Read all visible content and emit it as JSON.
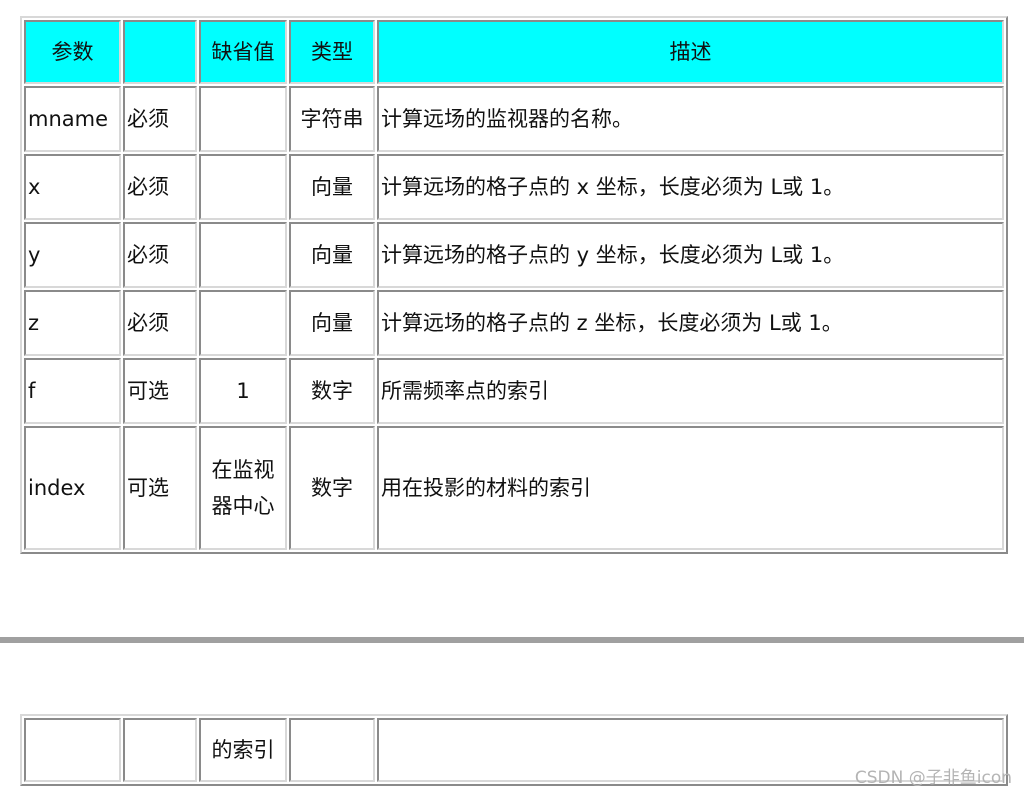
{
  "table": {
    "headers": [
      "参数",
      "",
      "缺省值",
      "类型",
      "描述"
    ],
    "rows": [
      {
        "param": "mname",
        "required": "必须",
        "default": "",
        "type": "字符串",
        "description": "计算远场的监视器的名称。"
      },
      {
        "param": "x",
        "required": "必须",
        "default": "",
        "type": "向量",
        "description": "计算远场的格子点的 x 坐标，长度必须为 L或 1。"
      },
      {
        "param": "y",
        "required": "必须",
        "default": "",
        "type": "向量",
        "description": "计算远场的格子点的 y 坐标，长度必须为 L或 1。"
      },
      {
        "param": "z",
        "required": "必须",
        "default": "",
        "type": "向量",
        "description": "计算远场的格子点的 z 坐标，长度必须为 L或 1。"
      },
      {
        "param": "f",
        "required": "可选",
        "default": "1",
        "type": "数字",
        "description": "所需频率点的索引"
      },
      {
        "param": "index",
        "required": "可选",
        "default": "在监视器中心",
        "type": "数字",
        "description": "用在投影的材料的索引"
      }
    ]
  },
  "continued_table": {
    "row": {
      "param": "",
      "required": "",
      "default": "的索引",
      "type": "",
      "description": ""
    }
  },
  "watermark": "CSDN @子非鱼icon",
  "colors": {
    "header_background": "#00ffff",
    "separator": "#a0a0a0"
  }
}
